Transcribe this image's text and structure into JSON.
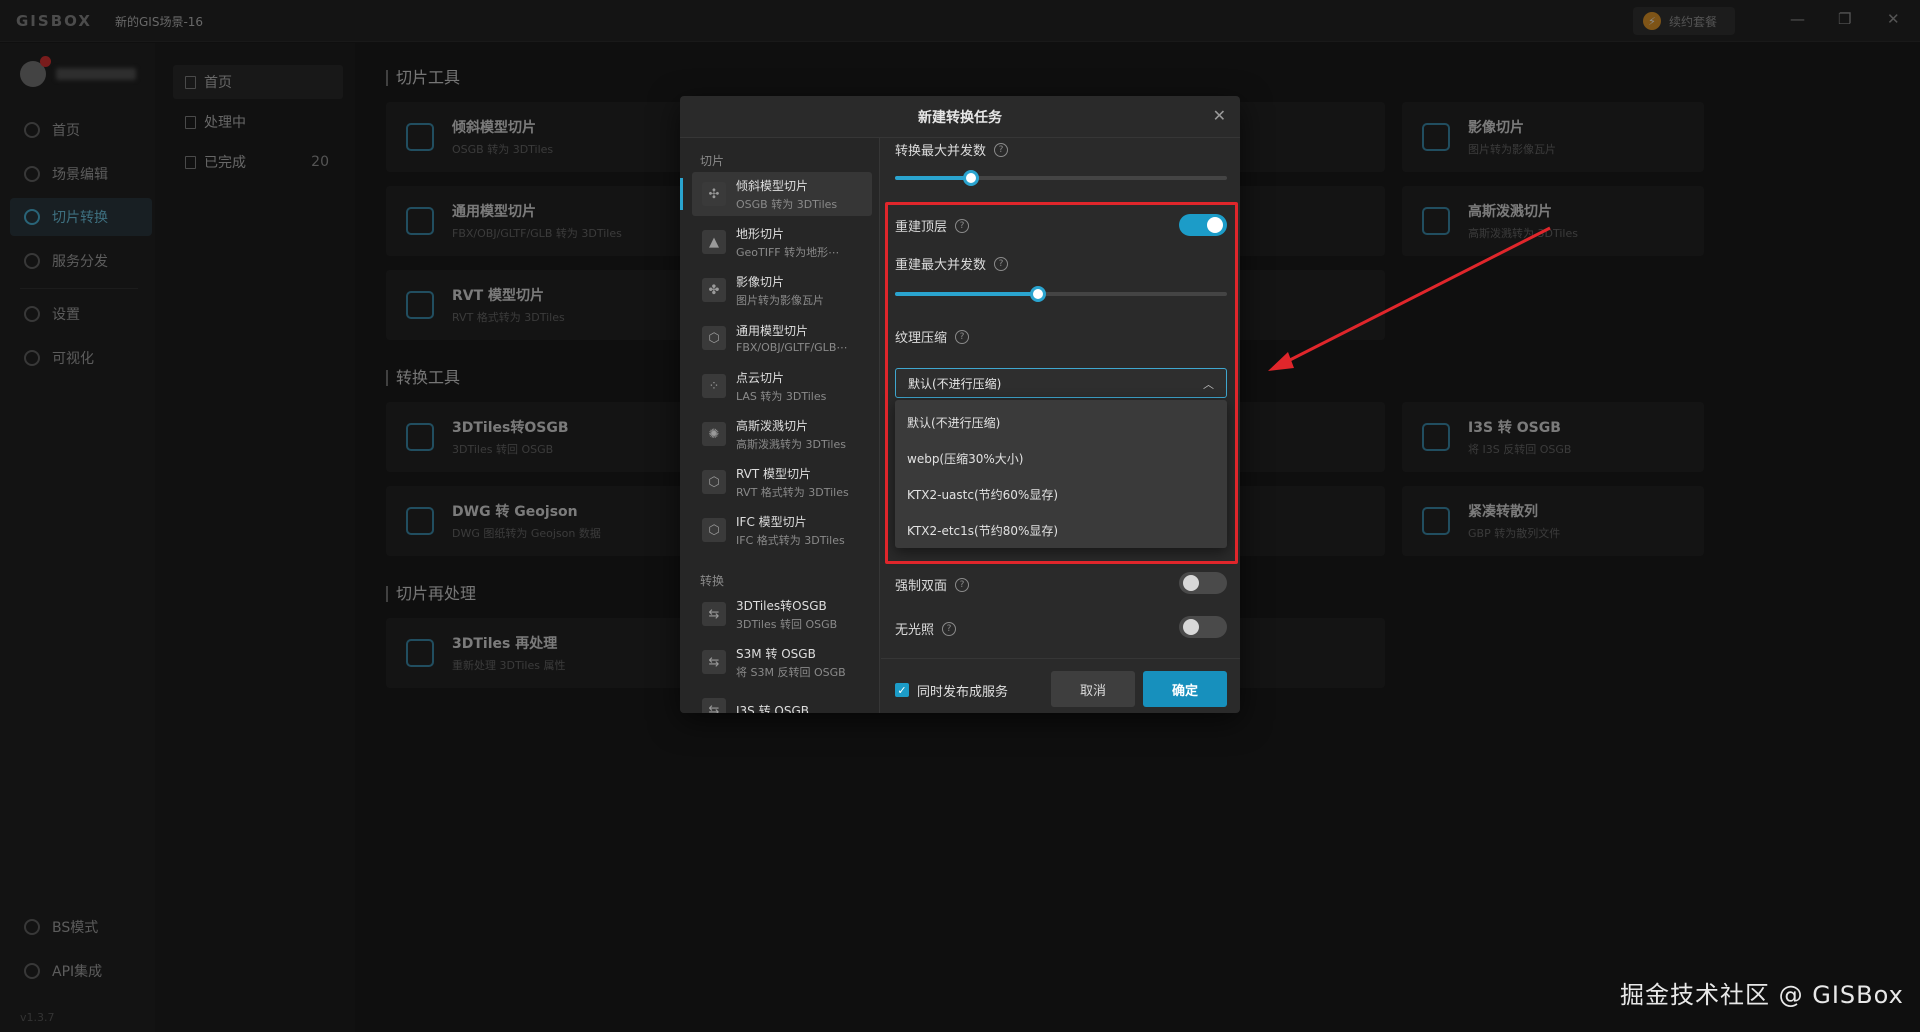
{
  "app": {
    "logo": "GISBOX",
    "scene": "新的GIS场景-16",
    "renew": "续约套餐",
    "renew_icon": "bolt-icon"
  },
  "nav": {
    "items": [
      {
        "label": "首页",
        "icon": "home-icon"
      },
      {
        "label": "场景编辑",
        "icon": "edit-icon"
      },
      {
        "label": "切片转换",
        "icon": "convert-icon"
      },
      {
        "label": "服务分发",
        "icon": "upload-icon"
      },
      {
        "label": "设置",
        "icon": "gear-icon"
      },
      {
        "label": "可视化",
        "icon": "visual-icon"
      },
      {
        "label": "BS模式",
        "icon": "code-icon"
      },
      {
        "label": "API集成",
        "icon": "link-icon"
      }
    ],
    "version": "v1.3.7"
  },
  "subnav": {
    "items": [
      {
        "label": "首页",
        "count": ""
      },
      {
        "label": "处理中",
        "count": ""
      },
      {
        "label": "已完成",
        "count": "20"
      }
    ]
  },
  "main": {
    "sections": [
      "切片工具",
      "转换工具",
      "切片再处理"
    ],
    "cards": [
      {
        "title": "倾斜模型切片",
        "sub": "OSGB 转为 3DTiles"
      },
      {
        "title": "通用模型切片",
        "sub": "FBX/OBJ/GLTF/GLB 转为 3DTiles"
      },
      {
        "title": "RVT 模型切片",
        "sub": "RVT 格式转为 3DTiles"
      },
      {
        "title": "3DTiles转OSGB",
        "sub": "3DTiles 转回 OSGB"
      },
      {
        "title": "DWG 转 Geojson",
        "sub": "DWG 图纸转为 Geojson 数据"
      },
      {
        "title": "3DTiles 再处理",
        "sub": "重新处理 3DTiles 属性"
      },
      {
        "title": "影像切片",
        "sub": "图片转为影像瓦片"
      },
      {
        "title": "高斯泼溅切片",
        "sub": "高斯泼溅转为 3DTiles"
      },
      {
        "title": "I3S 转 OSGB",
        "sub": "将 I3S 反转回 OSGB"
      },
      {
        "title": "紧凑转散列",
        "sub": "GBP 转为散列文件"
      }
    ]
  },
  "dialog": {
    "title": "新建转换任务",
    "groups": [
      "切片",
      "转换"
    ],
    "tools": [
      {
        "title": "倾斜模型切片",
        "sub": "OSGB 转为 3DTiles"
      },
      {
        "title": "地形切片",
        "sub": "GeoTIFF 转为地形⋯"
      },
      {
        "title": "影像切片",
        "sub": "图片转为影像瓦片"
      },
      {
        "title": "通用模型切片",
        "sub": "FBX/OBJ/GLTF/GLB⋯"
      },
      {
        "title": "点云切片",
        "sub": "LAS 转为 3DTiles"
      },
      {
        "title": "高斯泼溅切片",
        "sub": "高斯泼溅转为 3DTiles"
      },
      {
        "title": "RVT 模型切片",
        "sub": "RVT 格式转为 3DTiles"
      },
      {
        "title": "IFC 模型切片",
        "sub": "IFC 格式转为 3DTiles"
      },
      {
        "title": "3DTiles转OSGB",
        "sub": "3DTiles 转回 OSGB"
      },
      {
        "title": "S3M 转 OSGB",
        "sub": "将 S3M 反转回 OSGB"
      },
      {
        "title": "I3S 转 OSGB",
        "sub": ""
      }
    ],
    "form": {
      "max_concurrency_label": "转换最大并发数",
      "max_concurrency_value": 0.23,
      "rebuild_top_label": "重建顶层",
      "rebuild_top_on": true,
      "rebuild_concurrency_label": "重建最大并发数",
      "rebuild_concurrency_value": 0.43,
      "texture_label": "纹理压缩",
      "texture_selected": "默认(不进行压缩)",
      "texture_options": [
        "默认(不进行压缩)",
        "webp(压缩30%大小)",
        "KTX2-uastc(节约60%显存)",
        "KTX2-etc1s(节约80%显存)"
      ],
      "double_side_label": "强制双面",
      "double_side_on": false,
      "unlit_label": "无光照",
      "unlit_on": false,
      "publish_label": "同时发布成服务",
      "publish_checked": true,
      "cancel": "取消",
      "ok": "确定"
    }
  },
  "watermark": "掘金技术社区 @ GISBox",
  "colors": {
    "accent": "#1c9cc8",
    "highlight": "#e0262b"
  }
}
